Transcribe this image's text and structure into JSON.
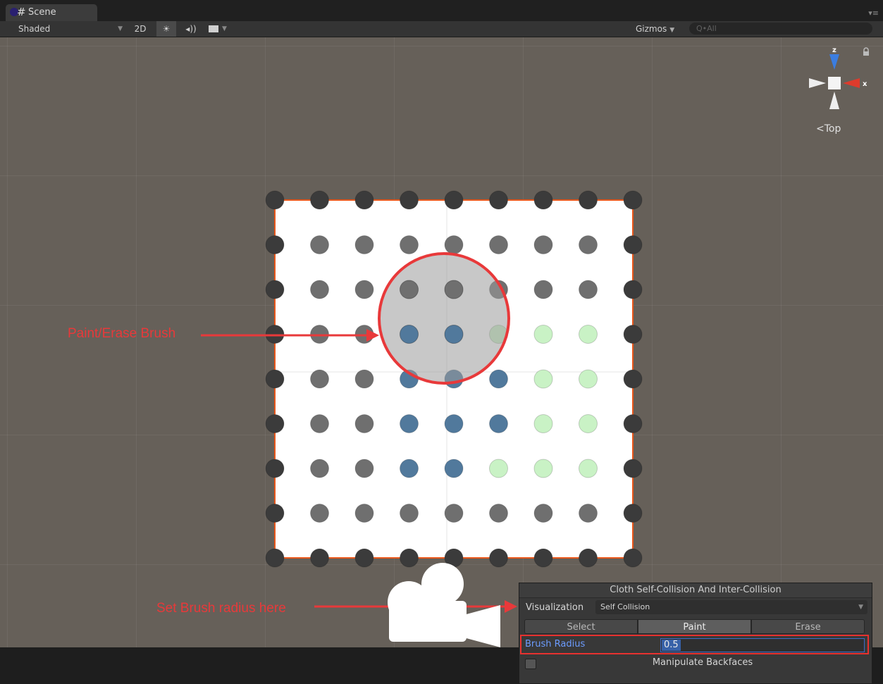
{
  "window": {
    "tab_label": "Scene",
    "tab_icon": "scene-hash-icon"
  },
  "toolbar": {
    "shading_mode": "Shaded",
    "mode_2d_label": "2D",
    "gizmos_label": "Gizmos",
    "search_placeholder": "Q•All"
  },
  "scene_gizmo": {
    "z_label": "z",
    "x_label": "x",
    "view_label": "<Top"
  },
  "annotations": {
    "brush_label": "Paint/Erase Brush",
    "radius_label": "Set Brush radius here",
    "color": "#e8393a"
  },
  "cloth": {
    "columns": 9,
    "rows": 9,
    "particle_states": [
      [
        "dark",
        "dark",
        "dark",
        "dark",
        "dark",
        "dark",
        "dark",
        "dark",
        "dark"
      ],
      [
        "dark",
        "gray",
        "gray",
        "gray",
        "gray",
        "gray",
        "gray",
        "gray",
        "dark"
      ],
      [
        "dark",
        "gray",
        "gray",
        "gray",
        "gray",
        "gray",
        "gray",
        "gray",
        "dark"
      ],
      [
        "dark",
        "gray",
        "gray",
        "blue",
        "blue",
        "green",
        "green",
        "green",
        "dark"
      ],
      [
        "dark",
        "gray",
        "gray",
        "blue",
        "blue",
        "blue",
        "green",
        "green",
        "dark"
      ],
      [
        "dark",
        "gray",
        "gray",
        "blue",
        "blue",
        "blue",
        "green",
        "green",
        "dark"
      ],
      [
        "dark",
        "gray",
        "gray",
        "blue",
        "blue",
        "green",
        "green",
        "green",
        "dark"
      ],
      [
        "dark",
        "gray",
        "gray",
        "gray",
        "gray",
        "gray",
        "gray",
        "gray",
        "dark"
      ],
      [
        "dark",
        "dark",
        "dark",
        "dark",
        "dark",
        "dark",
        "dark",
        "dark",
        "dark"
      ]
    ],
    "colors": {
      "dark": "#3b3b3b",
      "gray": "#6f6f6f",
      "blue": "#51799c",
      "green": "#c9f2c5",
      "outline": "#e8561a",
      "brush_fill": "#9a9a9a",
      "brush_stroke": "#e8393a"
    }
  },
  "panel": {
    "title": "Cloth Self-Collision And Inter-Collision",
    "visualization_label": "Visualization",
    "visualization_value": "Self Collision",
    "modes": [
      "Select",
      "Paint",
      "Erase"
    ],
    "active_mode": "Paint",
    "brush_radius_label": "Brush Radius",
    "brush_radius_value": "0.5",
    "backfaces_label": "Manipulate Backfaces",
    "backfaces_checked": false
  }
}
